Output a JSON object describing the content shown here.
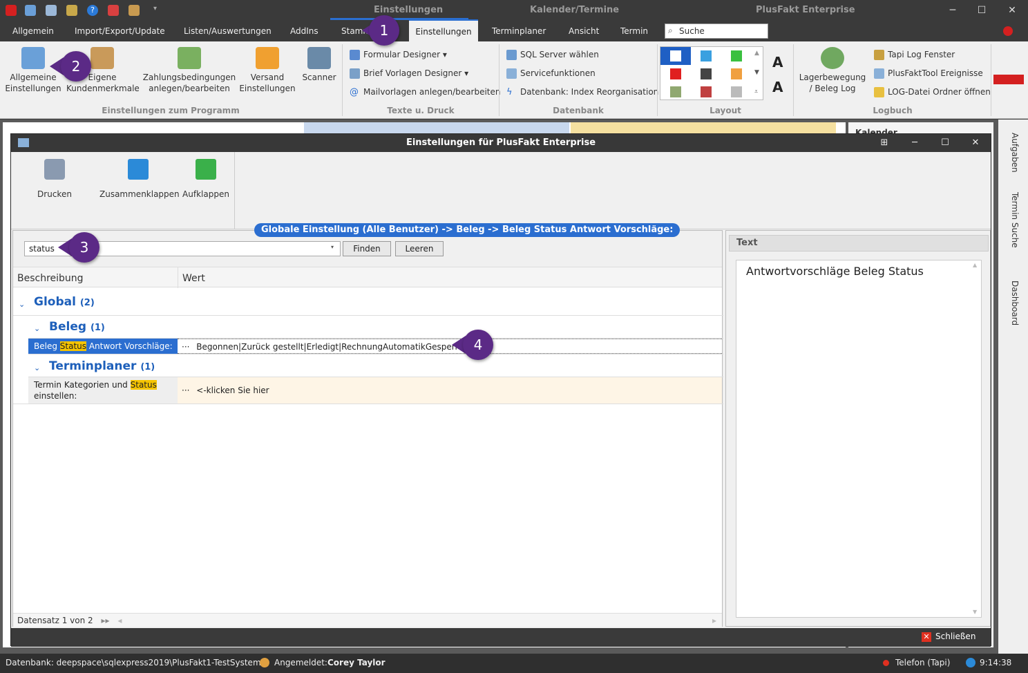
{
  "titlebar": {
    "tab1": "Einstellungen",
    "tab2": "Kalender/Termine",
    "app_title": "PlusFakt Enterprise",
    "minimize": "─",
    "maximize": "☐",
    "close": "✕"
  },
  "menu": {
    "items": [
      "Allgemein",
      "Import/Export/Update",
      "Listen/Auswertungen",
      "AddIns",
      "Stamm",
      "Einstellungen",
      "Terminplaner",
      "Ansicht",
      "Termin"
    ],
    "search_placeholder": "Suche"
  },
  "ribbon": {
    "group1": {
      "label": "Einstellungen zum Programm",
      "btn1": [
        "Allgemeine",
        "Einstellungen"
      ],
      "btn2": [
        "Eigene",
        "Kundenmerkmale"
      ],
      "btn3": [
        "Zahlungsbedingungen",
        "anlegen/bearbeiten"
      ],
      "btn4": [
        "Versand",
        "Einstellungen"
      ],
      "btn5": [
        "Scanner",
        ""
      ]
    },
    "group2": {
      "label": "Texte u. Druck",
      "items": [
        "Formular Designer ▾",
        "Brief Vorlagen Designer ▾",
        "Mailvorlagen anlegen/bearbeiten"
      ]
    },
    "group3": {
      "label": "Datenbank",
      "items": [
        "SQL Server wählen",
        "Servicefunktionen",
        "Datenbank: Index Reorganisation"
      ]
    },
    "group4": {
      "label": "Layout"
    },
    "group5": {
      "label": "Logbuch",
      "big": [
        "Lagerbewegung",
        "/ Beleg Log"
      ],
      "items": [
        "Tapi Log Fenster",
        "PlusFaktTool Ereignisse",
        "LOG-Datei Ordner öffnen"
      ]
    }
  },
  "background": {
    "calendar_label": "Kalender"
  },
  "dialog": {
    "title": "Einstellungen für PlusFakt Enterprise",
    "tools": [
      "Drucken",
      "Zusammenklappen",
      "Aufklappen"
    ],
    "path": "Globale Einstellung (Alle Benutzer) -> Beleg -> Beleg Status Antwort Vorschläge:",
    "find": {
      "value": "status",
      "find_btn": "Finden",
      "clear_btn": "Leeren"
    },
    "grid": {
      "col1": "Beschreibung",
      "col2": "Wert",
      "group_global": "Global",
      "group_global_count": "(2)",
      "group_beleg": "Beleg",
      "group_beleg_count": "(1)",
      "row1_pre": "Beleg ",
      "row1_hl": "Status",
      "row1_post": " Antwort Vorschläge:",
      "row1_value": "Begonnen|Zurück gestellt|Erledigt|RechnungAutomatikGesperrt",
      "group_termin": "Terminplaner",
      "group_termin_count": "(1)",
      "row2_pre": "Termin Kategorien und ",
      "row2_hl": "Status",
      "row2_post": "einstellen:",
      "row2_value": "<-klicken Sie hier",
      "ellipsis": "···"
    },
    "footer": "Datensatz 1 von 2",
    "text_panel": {
      "header": "Text",
      "content": "Antwortvorschläge Beleg Status"
    },
    "close_btn": "Schließen"
  },
  "right_dock": [
    "Aufgaben",
    "Termin Suche",
    "Dashboard"
  ],
  "statusbar": {
    "db": "Datenbank: deepspace\\sqlexpress2019\\PlusFakt1-TestSystem",
    "logged_in_label": "Angemeldet:",
    "user": "Corey Taylor",
    "phone": "Telefon (Tapi)",
    "time": "9:14:38"
  },
  "callouts": [
    "1",
    "2",
    "3",
    "4"
  ],
  "colors": {
    "accent": "#2b6ed0",
    "highlight": "#f5c400",
    "callout": "#5b2a86",
    "group_text": "#1d5fba"
  }
}
